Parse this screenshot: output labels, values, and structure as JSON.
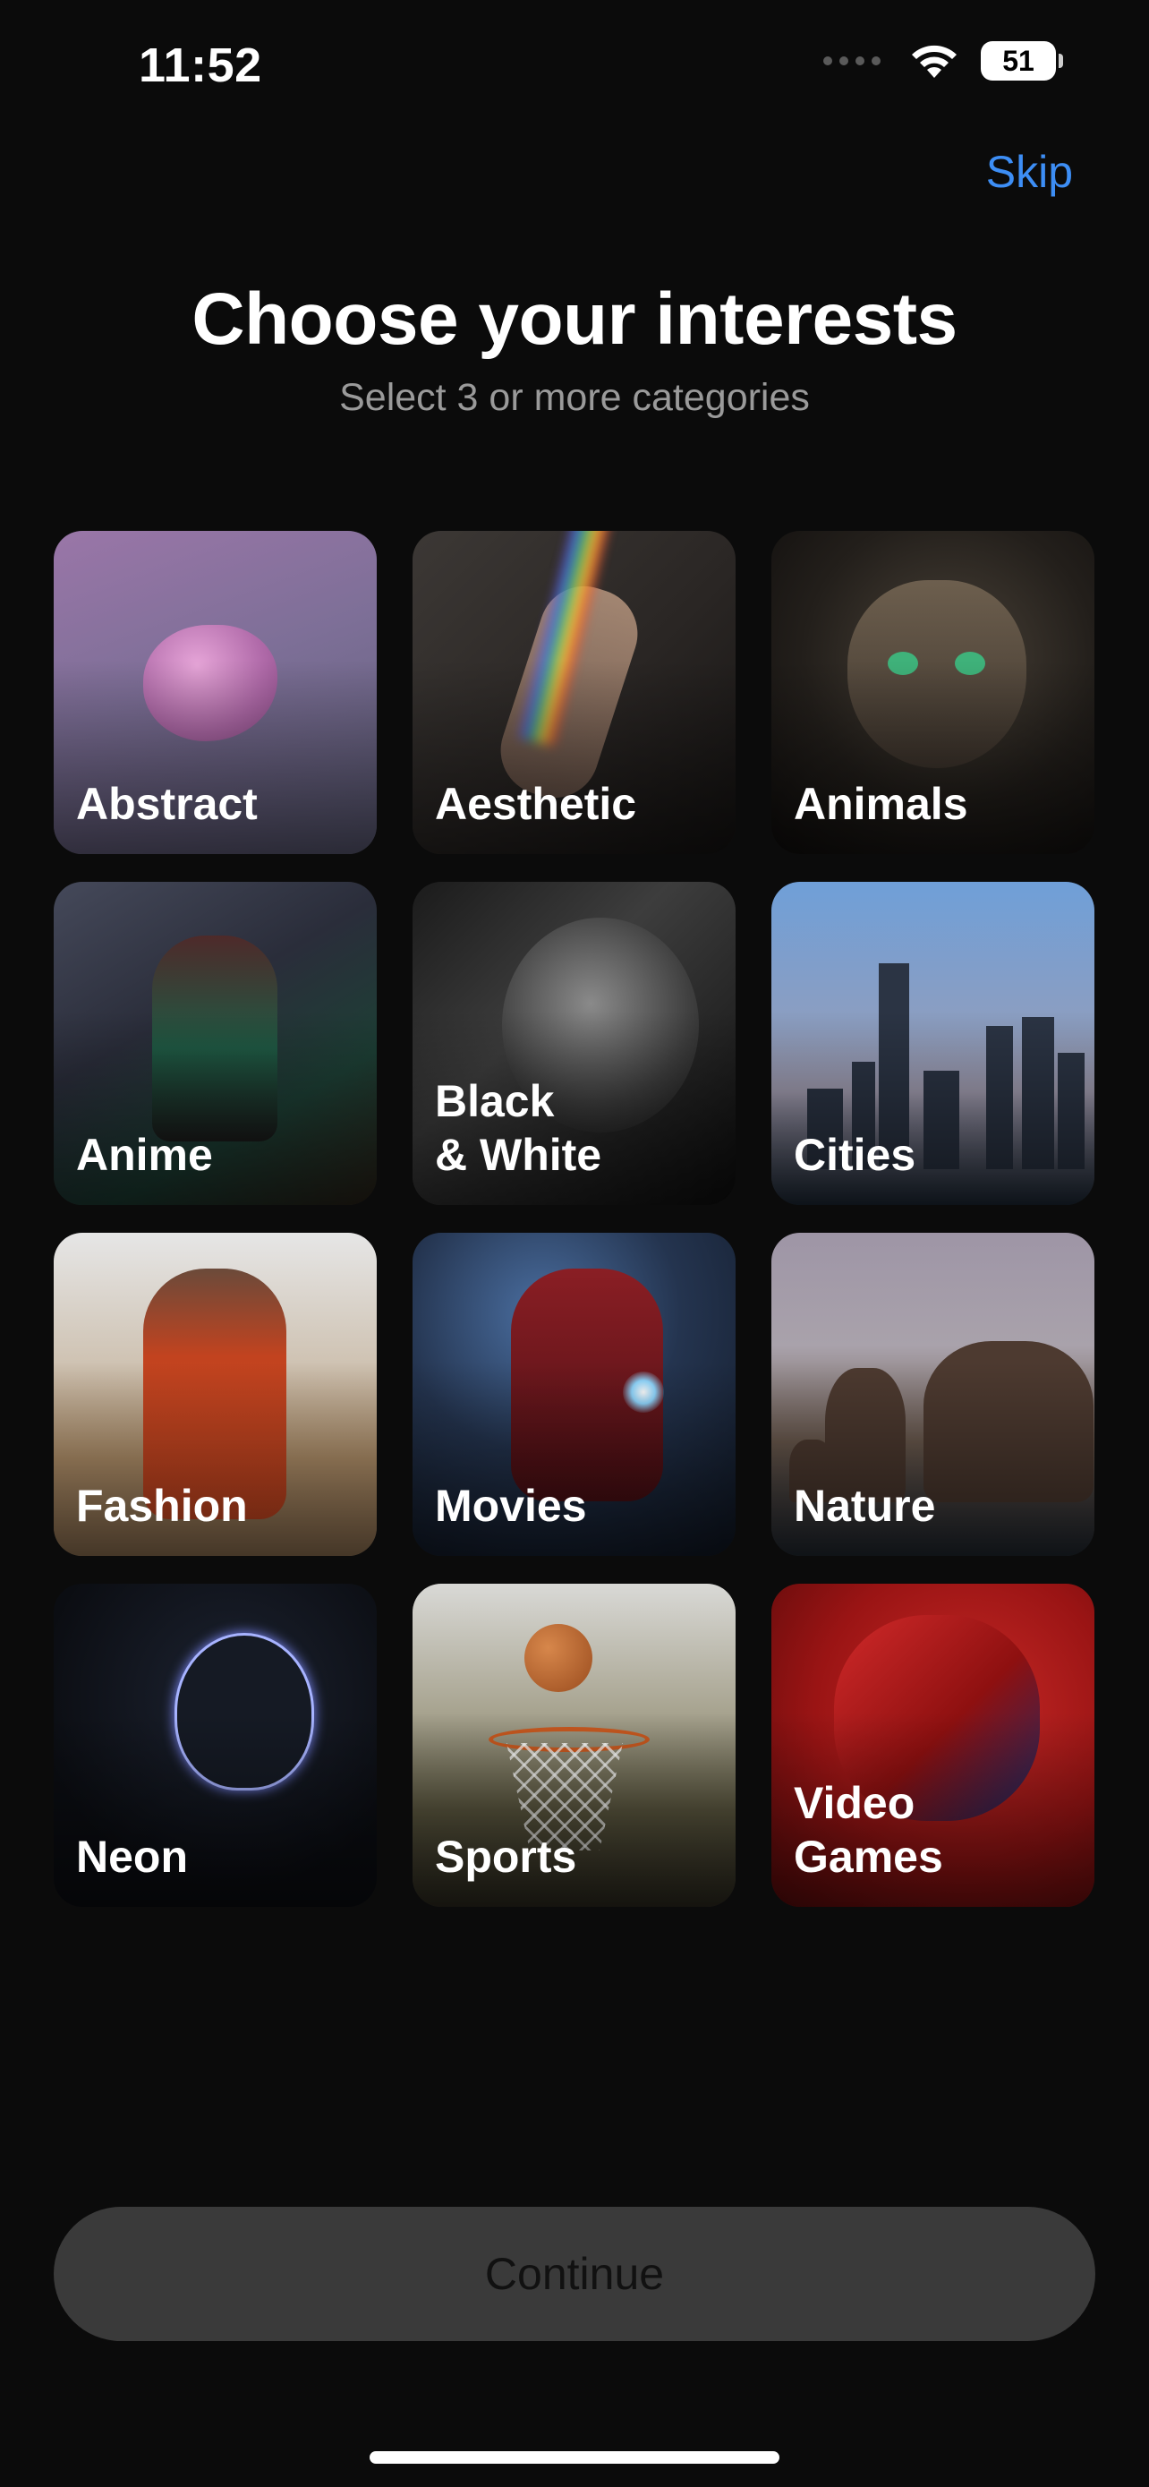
{
  "status_bar": {
    "time": "11:52",
    "battery_percent": "51",
    "icons": [
      "signal-icon",
      "wifi-icon",
      "battery-icon"
    ]
  },
  "header": {
    "skip_label": "Skip",
    "title": "Choose your interests",
    "subtitle": "Select 3 or more categories"
  },
  "categories": [
    {
      "label": "Abstract"
    },
    {
      "label": "Aesthetic"
    },
    {
      "label": "Animals"
    },
    {
      "label": "Anime"
    },
    {
      "label": "Black\n& White"
    },
    {
      "label": "Cities"
    },
    {
      "label": "Fashion"
    },
    {
      "label": "Movies"
    },
    {
      "label": "Nature"
    },
    {
      "label": "Neon"
    },
    {
      "label": "Sports"
    },
    {
      "label": "Video\nGames"
    }
  ],
  "footer": {
    "continue_label": "Continue"
  },
  "colors": {
    "background": "#0b0b0b",
    "accent": "#3d8ef5",
    "subtitle": "#9a9a9a",
    "button_disabled": "#3a3a3a"
  }
}
